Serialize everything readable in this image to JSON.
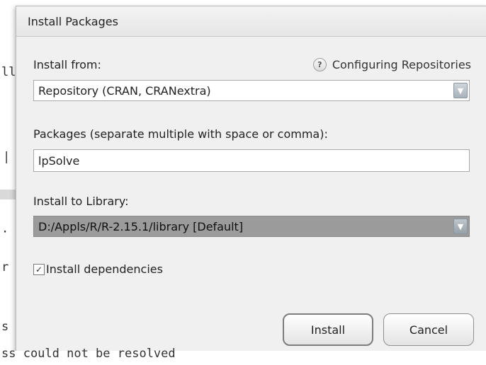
{
  "background": {
    "console_lines": {
      "line1": "ll",
      "line2": "|",
      "line3": "·",
      "line4": "r",
      "line5": "s",
      "bottom_line": "ss could not be resolved"
    }
  },
  "dialog": {
    "title": "Install Packages",
    "install_from": {
      "label": "Install from:",
      "value": "Repository (CRAN, CRANextra)"
    },
    "help": {
      "icon": "?",
      "link_text": "Configuring Repositories"
    },
    "packages": {
      "label": "Packages (separate multiple with space or comma):",
      "value": "lpSolve"
    },
    "library": {
      "label": "Install to Library:",
      "value": "D:/Appls/R/R-2.15.1/library [Default]"
    },
    "dependencies": {
      "checked": true,
      "label": "Install dependencies"
    },
    "buttons": {
      "install": "Install",
      "cancel": "Cancel"
    }
  }
}
